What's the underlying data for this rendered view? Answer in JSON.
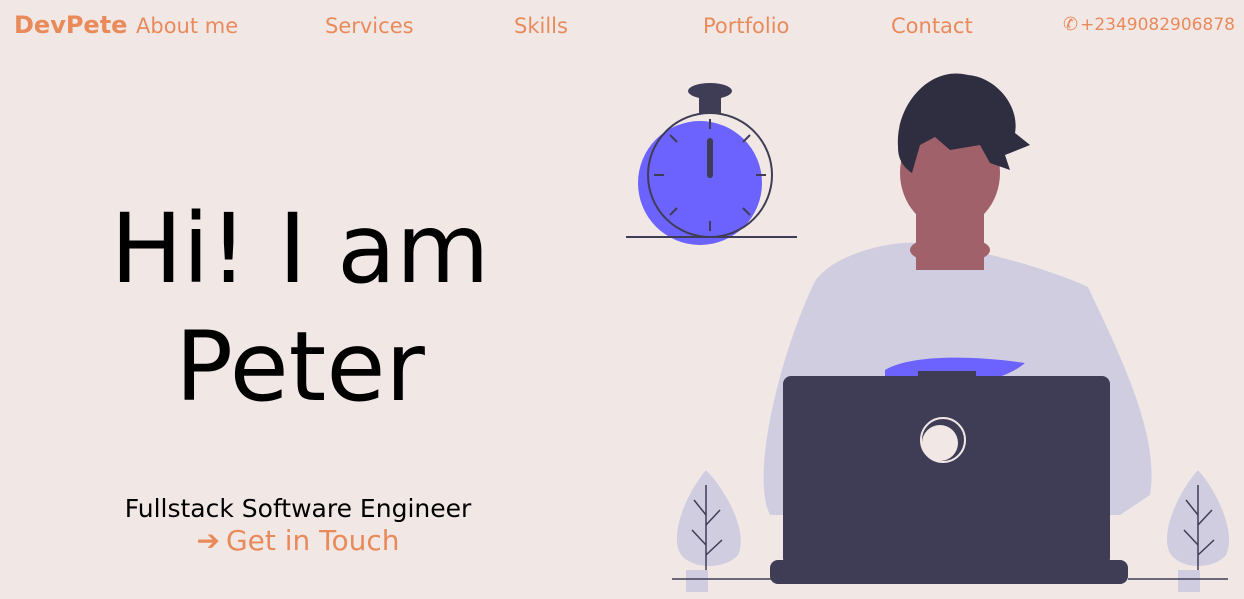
{
  "nav": {
    "brand": "DevPete",
    "links": [
      "About me",
      "Services",
      "Skills",
      "Portfolio",
      "Contact"
    ],
    "phone": "+2349082906878",
    "phone_icon": "phone-icon"
  },
  "hero": {
    "greeting_line1": "Hi! I am",
    "greeting_line2": "Peter",
    "role": "Fullstack Software Engineer",
    "cta_label": "Get in Touch",
    "cta_icon": "arrow-right-icon"
  },
  "colors": {
    "background": "#f1e8e6",
    "accent": "#e98a5b",
    "dark": "#3f3d56",
    "purple": "#6c63ff",
    "shirt": "#d0cde1",
    "skin": "#a0616a"
  }
}
